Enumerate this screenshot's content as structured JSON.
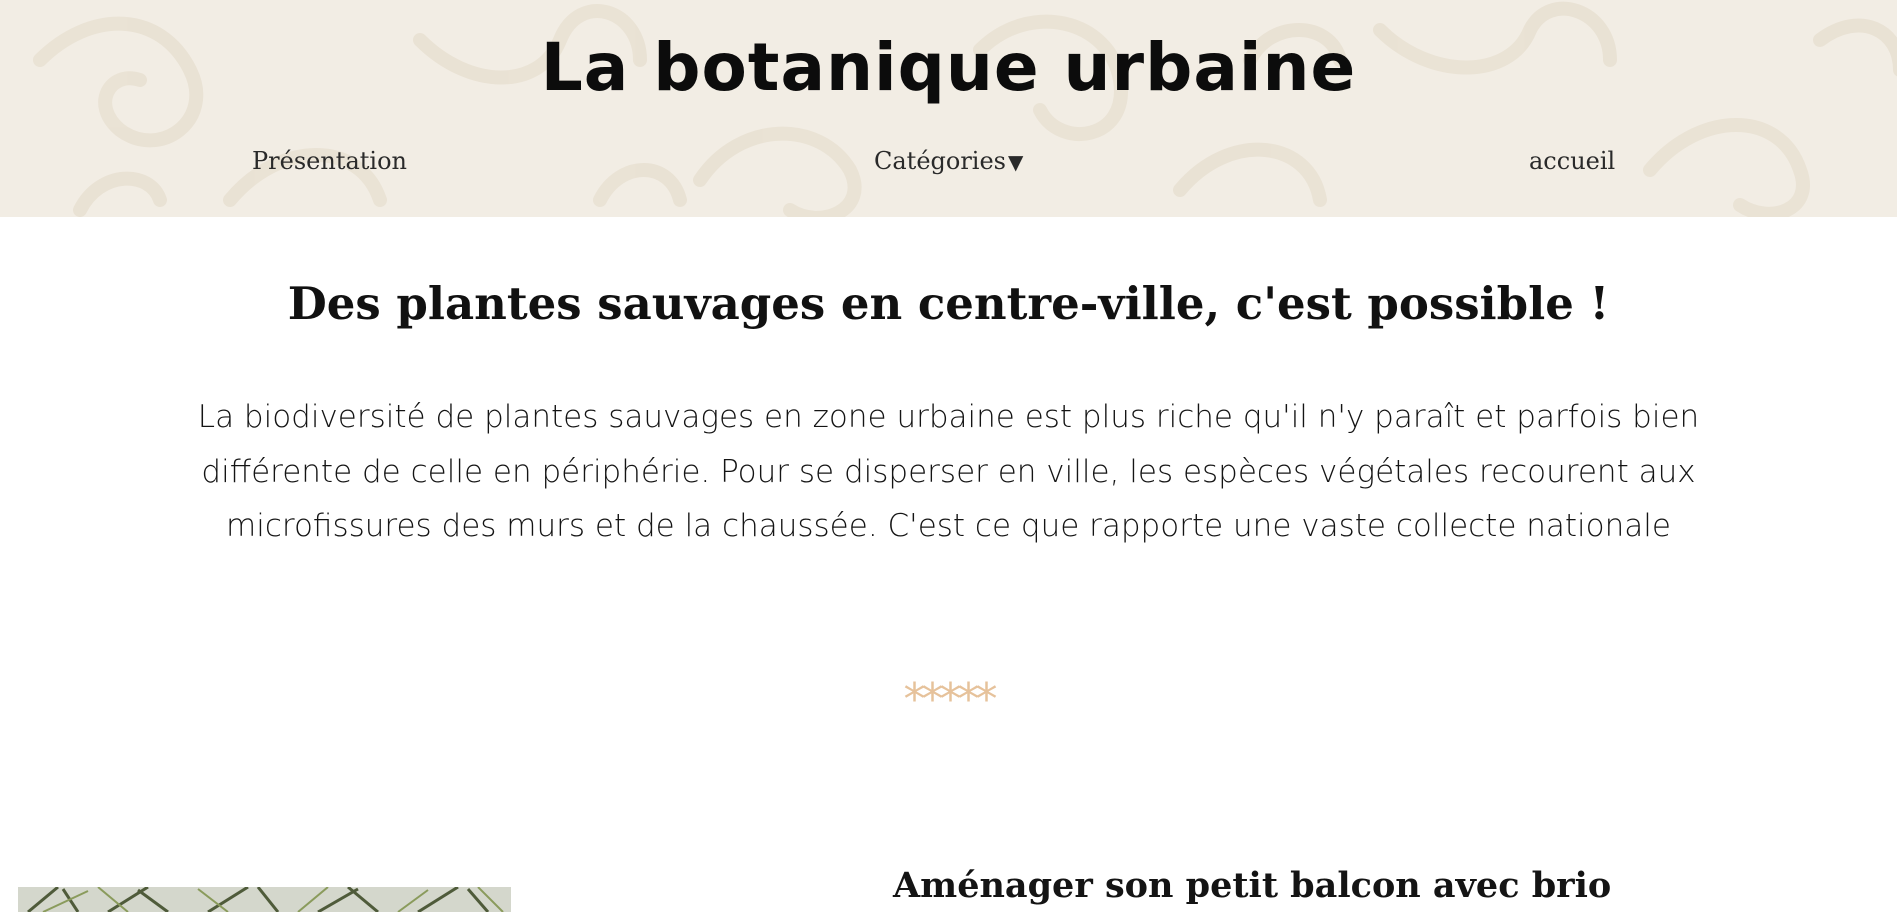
{
  "header": {
    "site_title": "La botanique urbaine",
    "background_color": "#f2ede4"
  },
  "nav": {
    "items": [
      {
        "label": "Présentation"
      },
      {
        "label": "Catégories",
        "has_dropdown": true,
        "caret": "▼"
      },
      {
        "label": "accueil"
      }
    ]
  },
  "main": {
    "heading": "Des plantes sauvages en centre-ville, c'est possible !",
    "intro": "La biodiversité de plantes sauvages en zone urbaine est plus riche qu'il n'y paraît et parfois bien différente de celle en périphérie. Pour se disperser en ville, les espèces végétales recourent aux microfissures des murs et de la chaussée. C'est ce que rapporte une vaste collecte nationale",
    "separator": "*****",
    "separator_color": "#e6c29b"
  },
  "article": {
    "title": "Aménager son petit balcon avec brio",
    "image_icon": "plant-photo-icon"
  }
}
